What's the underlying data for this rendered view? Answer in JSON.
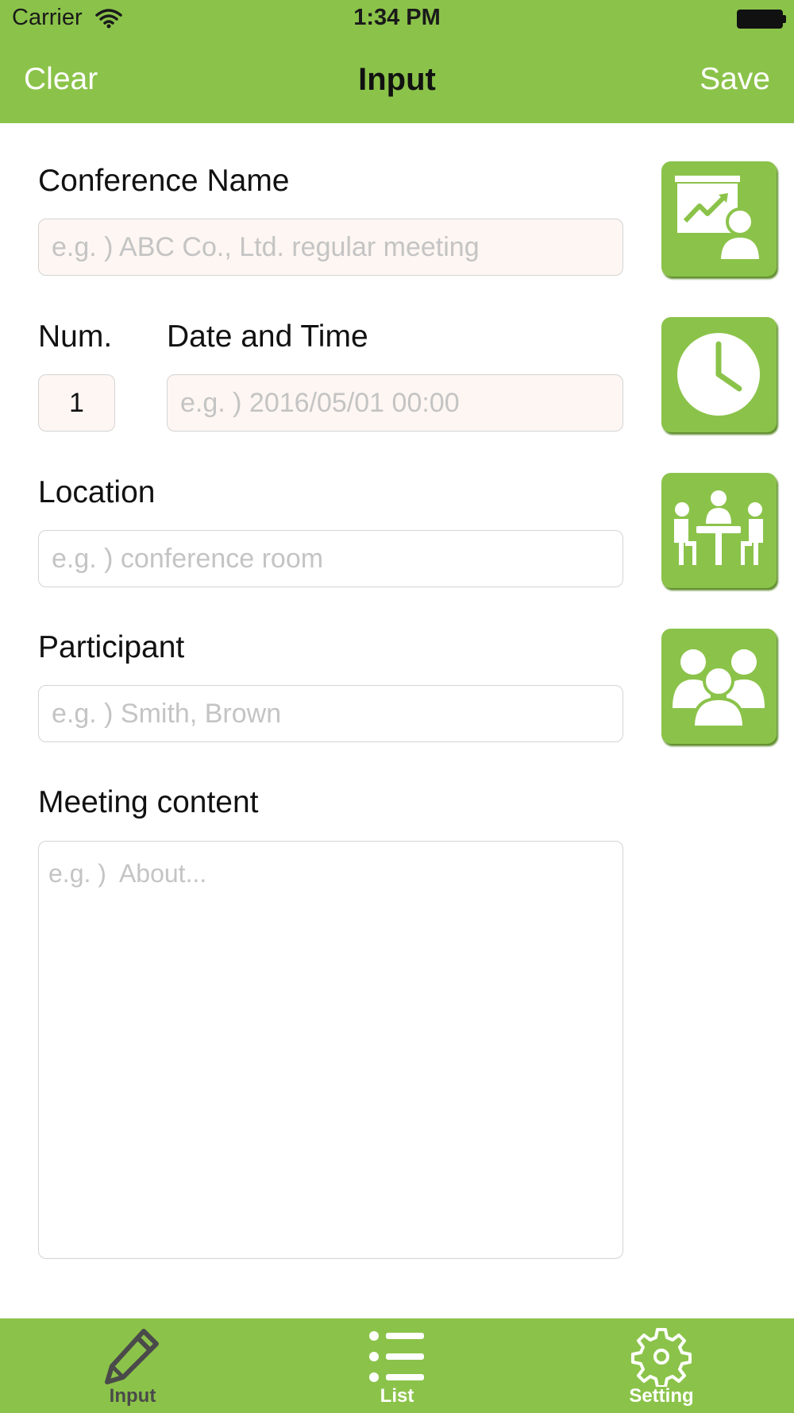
{
  "status_bar": {
    "carrier": "Carrier",
    "time": "1:34 PM"
  },
  "nav": {
    "left_button": "Clear",
    "title": "Input",
    "right_button": "Save"
  },
  "form": {
    "conference_name": {
      "label": "Conference Name",
      "placeholder": "e.g. ) ABC Co., Ltd. regular meeting",
      "value": ""
    },
    "num": {
      "label": "Num.",
      "value": "1"
    },
    "date_time": {
      "label": "Date and Time",
      "placeholder": "e.g. ) 2016/05/01 00:00",
      "value": ""
    },
    "location": {
      "label": "Location",
      "placeholder": "e.g. ) conference room",
      "value": ""
    },
    "participant": {
      "label": "Participant",
      "placeholder": "e.g. ) Smith, Brown",
      "value": ""
    },
    "meeting_content": {
      "label": "Meeting content",
      "placeholder": "e.g. )  About...",
      "value": ""
    }
  },
  "side_icons": [
    "presentation-icon",
    "clock-icon",
    "meeting-table-icon",
    "group-icon"
  ],
  "tabs": [
    {
      "label": "Input",
      "icon": "pencil-icon",
      "active": true
    },
    {
      "label": "List",
      "icon": "list-icon",
      "active": false
    },
    {
      "label": "Setting",
      "icon": "gear-icon",
      "active": false
    }
  ],
  "colors": {
    "accent": "#8bc34a",
    "active_tab": "#4a4a4a",
    "placeholder": "#c4c4c4"
  }
}
